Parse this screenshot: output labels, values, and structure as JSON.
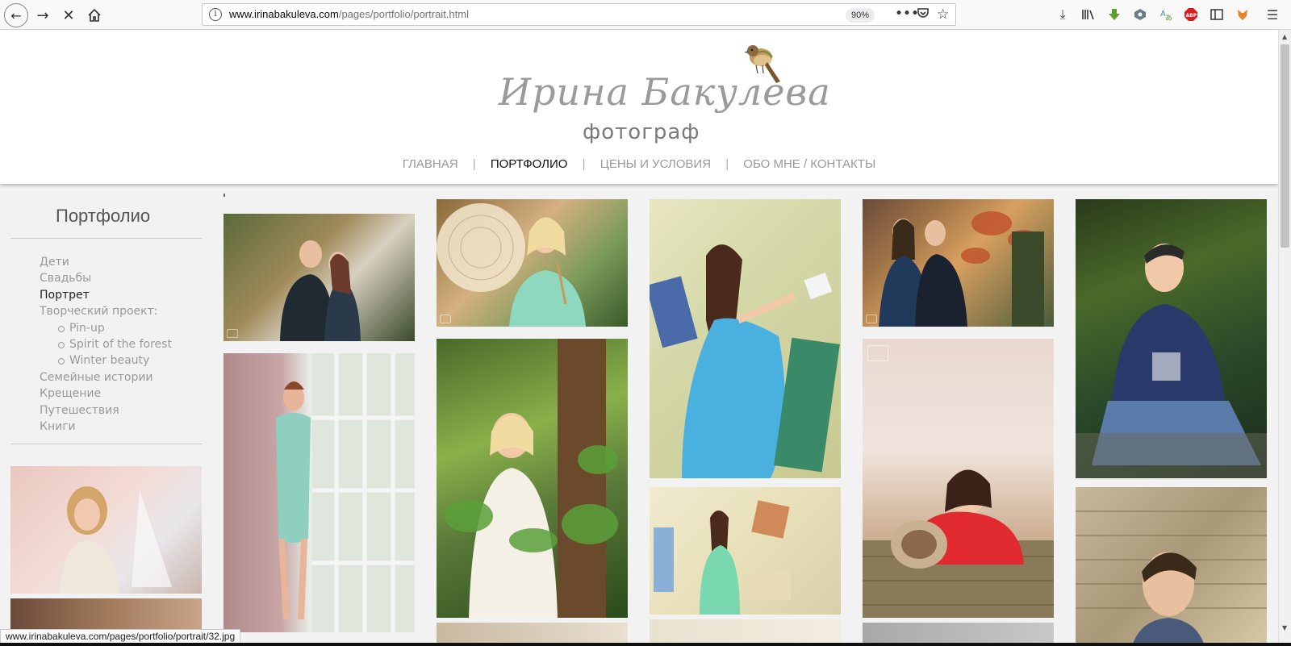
{
  "browser": {
    "url_domain": "www.irinabakuleva.com",
    "url_path": "/pages/portfolio/portrait.html",
    "zoom": "90%",
    "status_url": "www.irinabakuleva.com/pages/portfolio/portrait/32.jpg"
  },
  "header": {
    "logo_script": "Ирина Бакулева",
    "logo_sub": "фотограф"
  },
  "nav": {
    "items": [
      {
        "label": "ГЛАВНАЯ"
      },
      {
        "label": "ПОРТФОЛИО"
      },
      {
        "label": "ЦЕНЫ И УСЛОВИЯ"
      },
      {
        "label": "ОБО МНЕ / КОНТАКТЫ"
      }
    ],
    "separator": "|"
  },
  "sidebar": {
    "title": "Портфолио",
    "items": [
      {
        "label": "Дети"
      },
      {
        "label": "Свадьбы"
      },
      {
        "label": "Портрет"
      },
      {
        "label": "Творческий проект:"
      },
      {
        "label": "Pin-up"
      },
      {
        "label": "Spirit of the forest"
      },
      {
        "label": "Winter beauty"
      },
      {
        "label": "Семейные истории"
      },
      {
        "label": "Крещение"
      },
      {
        "label": "Путешествия"
      },
      {
        "label": "Книги"
      }
    ]
  },
  "icons": {
    "back": "arrow-left-icon",
    "forward": "arrow-right-icon",
    "stop": "close-icon",
    "home": "home-icon",
    "info": "info-icon",
    "more": "more-icon",
    "pocket": "pocket-icon",
    "bookmark": "star-icon",
    "download": "download-icon",
    "library": "library-icon",
    "menu": "hamburger-icon"
  }
}
